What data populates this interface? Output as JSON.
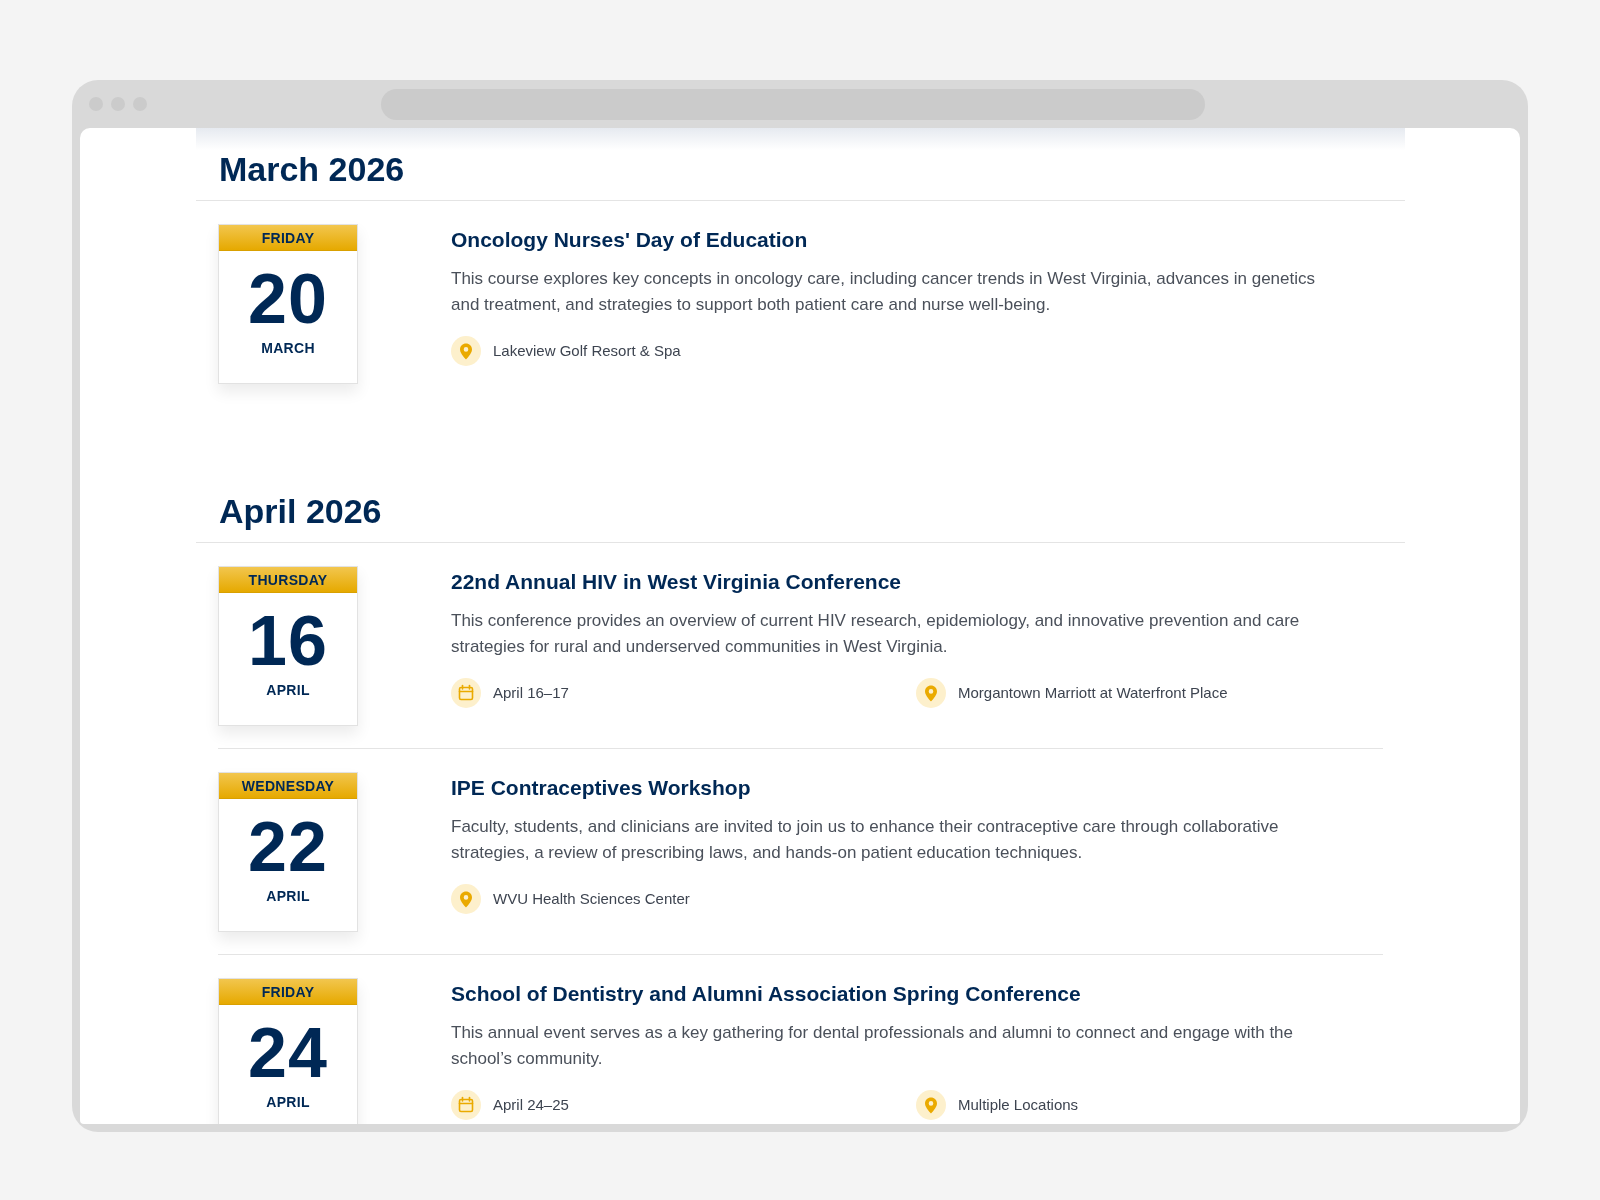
{
  "sections": [
    {
      "heading": "March 2026",
      "events": [
        {
          "weekday": "FRIDAY",
          "day": "20",
          "month": "MARCH",
          "title": "Oncology Nurses' Day of Education",
          "description": "This course explores key concepts in oncology care, including cancer trends in West Virginia, advances in genetics and treatment, and strategies to support both patient care and nurse well-being.",
          "meta": [
            {
              "kind": "location",
              "text": "Lakeview Golf Resort & Spa"
            }
          ]
        }
      ]
    },
    {
      "heading": "April 2026",
      "events": [
        {
          "weekday": "THURSDAY",
          "day": "16",
          "month": "APRIL",
          "title": "22nd Annual HIV in West Virginia Conference",
          "description": "This conference provides an overview of current HIV research, epidemiology, and innovative prevention and care strategies for rural and underserved communities in West Virginia.",
          "meta": [
            {
              "kind": "date",
              "text": "April 16–17"
            },
            {
              "kind": "location",
              "text": "Morgantown Marriott at Waterfront Place"
            }
          ]
        },
        {
          "weekday": "WEDNESDAY",
          "day": "22",
          "month": "APRIL",
          "title": "IPE Contraceptives Workshop",
          "description": "Faculty, students, and clinicians are invited to join us to enhance their contraceptive care through collaborative strategies, a review of prescribing laws, and hands-on patient education techniques.",
          "meta": [
            {
              "kind": "location",
              "text": "WVU Health Sciences Center"
            }
          ]
        },
        {
          "weekday": "FRIDAY",
          "day": "24",
          "month": "APRIL",
          "title": "School of Dentistry and Alumni Association Spring Conference",
          "description": "This annual event serves as a key gathering for dental professionals and alumni to connect and engage with the school’s community.",
          "meta": [
            {
              "kind": "date",
              "text": "April 24–25"
            },
            {
              "kind": "location",
              "text": "Multiple Locations"
            }
          ]
        }
      ]
    }
  ]
}
